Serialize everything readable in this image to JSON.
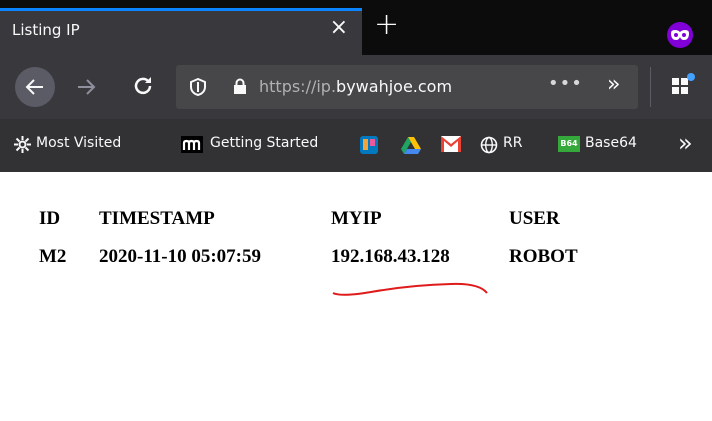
{
  "tab": {
    "title": "Listing IP",
    "close": "×",
    "new_tab": "+"
  },
  "navbar": {
    "url_prefix": "https://ip.",
    "url_host": "bywahjoe.com",
    "page_actions": "•••",
    "overflow": "»"
  },
  "bookmarks": {
    "items": [
      {
        "label": "Most Visited",
        "icon": "gear-icon"
      },
      {
        "label": "Getting Started",
        "icon": "m-logo-icon"
      },
      {
        "label": "",
        "icon": "trello-icon"
      },
      {
        "label": "",
        "icon": "google-drive-icon"
      },
      {
        "label": "",
        "icon": "gmail-icon"
      },
      {
        "label": "RR",
        "icon": "globe-icon"
      },
      {
        "label": "Base64",
        "icon": "b64-icon"
      }
    ],
    "overflow": "»",
    "b64_badge": "B64"
  },
  "table": {
    "headers": [
      "ID",
      "TIMESTAMP",
      "MYIP",
      "USER"
    ],
    "rows": [
      [
        "M2",
        "2020-11-10 05:07:59",
        "192.168.43.128",
        "ROBOT"
      ]
    ]
  },
  "colors": {
    "accent": "#0a84ff",
    "private": "#8000d7",
    "underline": "#e01b1b"
  }
}
